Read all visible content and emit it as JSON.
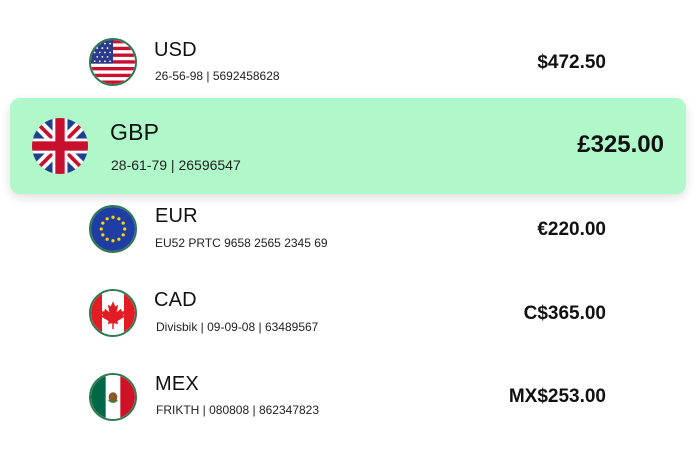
{
  "accounts": [
    {
      "code": "USD",
      "details": "26-56-98 | 5692458628",
      "amount": "$472.50",
      "flag": "us-flag-icon",
      "selected": false
    },
    {
      "code": "GBP",
      "details": "28-61-79 | 26596547",
      "amount": "£325.00",
      "flag": "uk-flag-icon",
      "selected": true
    },
    {
      "code": "EUR",
      "details": "EU52 PRTC 9658 2565 2345 69",
      "amount": "€220.00",
      "flag": "eu-flag-icon",
      "selected": false
    },
    {
      "code": "CAD",
      "details": "Divisbik | 09-09-08 | 63489567",
      "amount": "C$365.00",
      "flag": "canada-flag-icon",
      "selected": false
    },
    {
      "code": "MEX",
      "details": "FRIKTH | 080808 | 862347823",
      "amount": "MX$253.00",
      "flag": "mexico-flag-icon",
      "selected": false
    }
  ],
  "colors": {
    "selected_background": "#b0f7ca",
    "flag_border": "#2e7a52"
  }
}
